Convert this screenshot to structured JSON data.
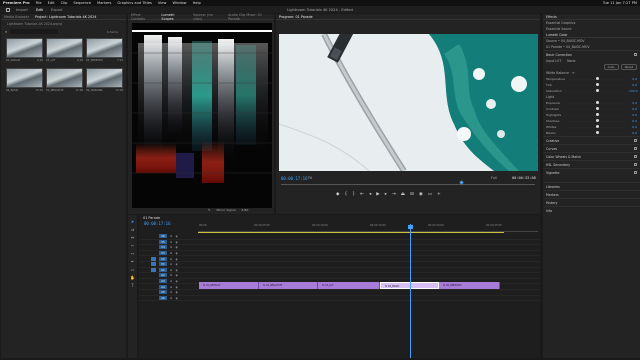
{
  "menubar": {
    "app": "Premiere Pro",
    "items": [
      "File",
      "Edit",
      "Clip",
      "Sequence",
      "Markers",
      "Graphics and Titles",
      "View",
      "Window",
      "Help"
    ],
    "clock": "Tue 11 Jan  7:27 PM"
  },
  "header": {
    "tabs": [
      "Import",
      "Edit",
      "Export"
    ],
    "active_tab": "Edit",
    "title": "Lightroom Tutorials 4K 2024 - Edited"
  },
  "project": {
    "tabs": [
      "Media Browser",
      "Project: Lightroom Tutorials 4K 2024"
    ],
    "path": "Lightroom Tutorials 4K 2024.prproj",
    "count": "6 Items",
    "clips": [
      {
        "name": "01_Default",
        "dur": "6:20"
      },
      {
        "name": "03_LUT",
        "dur": "6:20"
      },
      {
        "name": "05_WB/EXPO",
        "dur": "7:10"
      },
      {
        "name": "04_BASIC",
        "dur": "15:20"
      },
      {
        "name": "02_NEGATIVE",
        "dur": "11:06"
      },
      {
        "name": "06_MASKING",
        "dur": "15:09"
      }
    ]
  },
  "scopes": {
    "tabs": [
      "Effect Controls",
      "Lumetri Scopes",
      "Source: (no clips)",
      "Audio Clip Mixer: 01 Parade"
    ],
    "active_tab": "Lumetri Scopes",
    "mirror": "Mirror Signal",
    "clamp": "8 Bit"
  },
  "program": {
    "tab": "Program: 01 Parade",
    "timecode": "00:00:17:16",
    "fit": "Fit",
    "quality": "Full",
    "duration": "00:00:33:08"
  },
  "lumetri": {
    "tabs": [
      "Effects",
      "Essential Graphics",
      "Essential Sound",
      "Lumetri Color"
    ],
    "source": "Source • 04_BASIC.MOV",
    "target": "01 Parade • 04_BASIC.MOV",
    "section_basic": "Basic Correction",
    "input_lut": "Input LUT",
    "input_lut_value": "None",
    "auto": "Auto",
    "reset": "Reset",
    "white_balance": "White Balance",
    "tone": "Tone",
    "light": "Light",
    "sliders": [
      {
        "label": "Temperature",
        "value": "0.0",
        "pos": 0.5
      },
      {
        "label": "Tint",
        "value": "0.0",
        "pos": 0.5
      },
      {
        "label": "Saturation",
        "value": "100.0",
        "pos": 0.5
      },
      {
        "label": "Exposure",
        "value": "0.0",
        "pos": 0.5
      },
      {
        "label": "Contrast",
        "value": "0.0",
        "pos": 0.5
      },
      {
        "label": "Highlights",
        "value": "0.0",
        "pos": 0.5
      },
      {
        "label": "Shadows",
        "value": "0.0",
        "pos": 0.5
      },
      {
        "label": "Whites",
        "value": "0.0",
        "pos": 0.5
      },
      {
        "label": "Blacks",
        "value": "0.0",
        "pos": 0.5
      }
    ],
    "sections": [
      "Creative",
      "Curves",
      "Color Wheels & Match",
      "HSL Secondary",
      "Vignette"
    ],
    "bottom_tabs": [
      "Libraries",
      "Markers",
      "History",
      "Info"
    ]
  },
  "timeline": {
    "sequence": "01 Parade",
    "timecode": "00:00:17:16",
    "ruler": [
      "00:00",
      "00:00:05:00",
      "00:00:10:00",
      "00:00:15:00",
      "00:00:20:00",
      "00:00:25:00"
    ],
    "video_tracks": [
      "V6",
      "V5",
      "V4",
      "V3",
      "V2",
      "V1"
    ],
    "audio_tracks": [
      "A1",
      "A2",
      "A3",
      "A4",
      "A5",
      "A6"
    ],
    "clips": [
      {
        "name": "fx 01_DEFAULT",
        "selected": false
      },
      {
        "name": "fx 02_NEGATIVE",
        "selected": false
      },
      {
        "name": "fx 03_LUT",
        "selected": false
      },
      {
        "name": "fx 04_BASIC",
        "selected": true
      },
      {
        "name": "fx 05_WB/EXPO",
        "selected": false
      }
    ]
  },
  "colors": {
    "accent": "#3fa3ff",
    "clip": "#a77bd8",
    "clip_selected": "#d7bff5",
    "panel": "#232323"
  }
}
